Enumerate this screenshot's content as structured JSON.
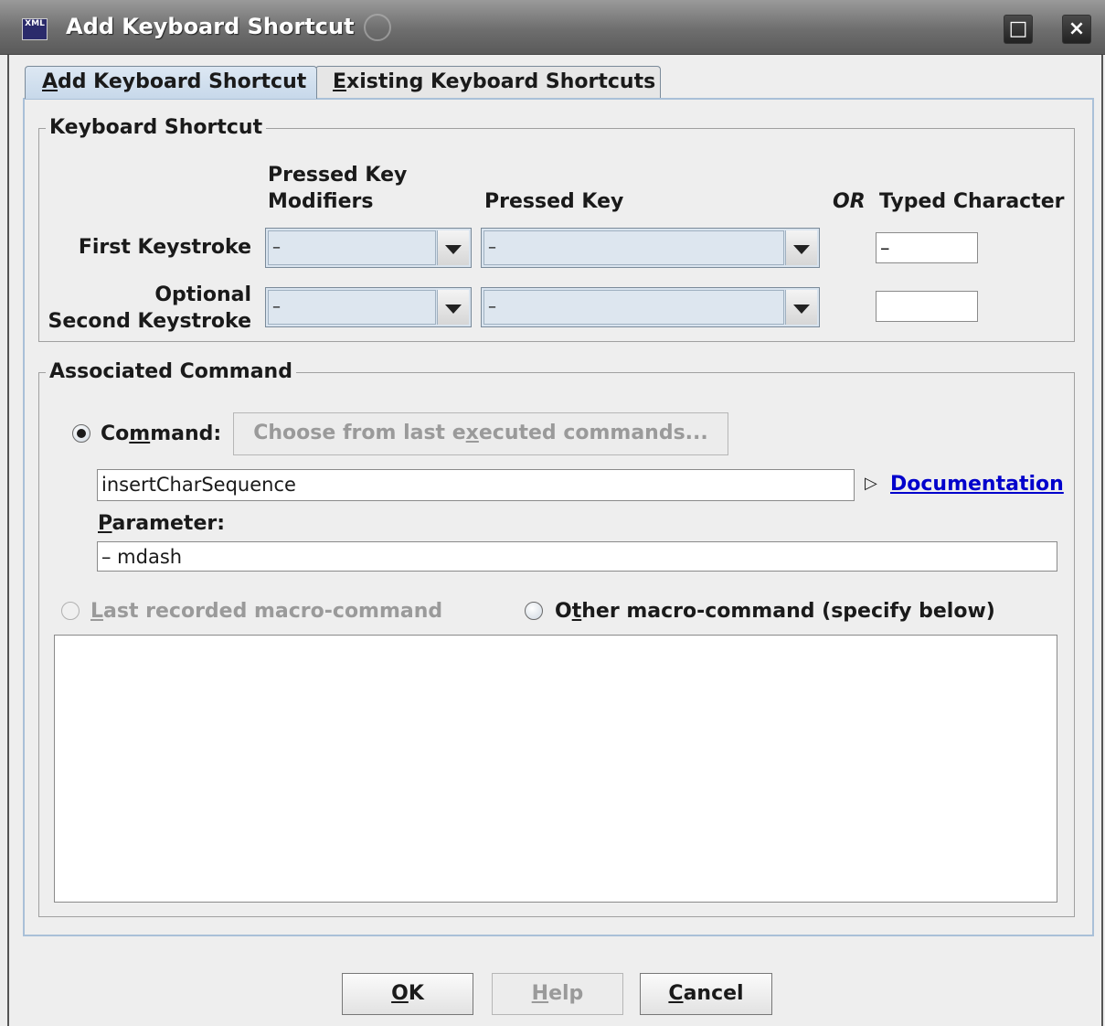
{
  "window": {
    "title": "Add Keyboard Shortcut",
    "app_icon_text": "XML",
    "maximize_glyph": "□",
    "close_glyph": "×"
  },
  "tabs": [
    {
      "label": "Add Keyboard Shortcut",
      "mnemonic": "A",
      "rest": "dd Keyboard Shortcut",
      "selected": true
    },
    {
      "label": "Existing Keyboard Shortcuts",
      "mnemonic": "E",
      "rest": "xisting Keyboard Shortcuts",
      "selected": false
    }
  ],
  "keyboard_shortcut": {
    "group_title": "Keyboard Shortcut",
    "header_modifiers_line1": "Pressed Key",
    "header_modifiers_line2": "Modifiers",
    "header_pressed_key": "Pressed Key",
    "header_or": "OR",
    "header_typed_char": "Typed Character",
    "first_label": "First Keystroke",
    "second_label_line1": "Optional",
    "second_label_line2": "Second Keystroke",
    "first": {
      "modifiers": "–",
      "key": "–",
      "typed": "–"
    },
    "second": {
      "modifiers": "–",
      "key": "–",
      "typed": ""
    }
  },
  "associated_command": {
    "group_title": "Associated Command",
    "command_radio": {
      "pre": "Co",
      "mnemonic": "m",
      "post": "mand:",
      "checked": true
    },
    "choose_button": {
      "pre": "Choose from last e",
      "mnemonic": "x",
      "post": "ecuted commands...",
      "enabled": false
    },
    "command_value": "insertCharSequence",
    "documentation_link": "Documentation",
    "documentation_arrow": "▷",
    "parameter_label": {
      "mnemonic": "P",
      "post": "arameter:"
    },
    "parameter_value": "– mdash",
    "last_macro_radio": {
      "mnemonic": "L",
      "post": "ast recorded macro-command",
      "checked": false,
      "enabled": false
    },
    "other_macro_radio": {
      "pre": "O",
      "mnemonic": "t",
      "post": "her macro-command (specify below)",
      "checked": false
    },
    "macro_text": ""
  },
  "buttons": {
    "ok": {
      "mnemonic": "O",
      "post": "K"
    },
    "help": {
      "mnemonic": "H",
      "post": "elp",
      "enabled": false
    },
    "cancel": {
      "mnemonic": "C",
      "post": "ancel"
    }
  },
  "colors": {
    "link": "#0000cc",
    "tab_selected": "#c7d8ea",
    "title_bar": "#6e6e6e"
  }
}
